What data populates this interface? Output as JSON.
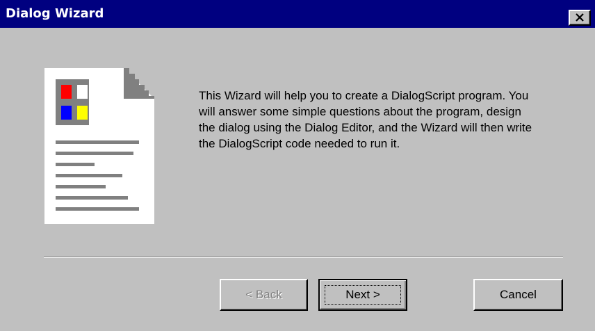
{
  "window": {
    "title": "Dialog Wizard",
    "close_icon": "close-icon"
  },
  "illustration": {
    "icon": "document-icon",
    "tile_colors": [
      "#ff0000",
      "#ffffff",
      "#0000ff",
      "#ffff00"
    ]
  },
  "content": {
    "intro": "This Wizard will help you to create a DialogScript program.  You will answer some simple questions about the program, design the dialog using the Dialog Editor, and the Wizard will then write the DialogScript code needed to run it."
  },
  "buttons": {
    "back_label": "< Back",
    "next_label": "Next >",
    "cancel_label": "Cancel"
  },
  "colors": {
    "titlebar": "#000080",
    "face": "#c0c0c0"
  }
}
